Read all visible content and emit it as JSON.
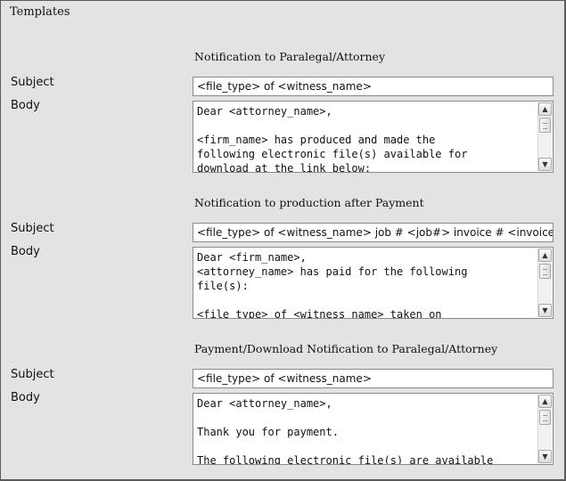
{
  "panel": {
    "title": "Templates"
  },
  "labels": {
    "subject": "Subject",
    "body": "Body"
  },
  "sections": [
    {
      "heading": "Notification to Paralegal/Attorney",
      "subject": "<file_type> of <witness_name>",
      "body": "Dear <attorney_name>,\n\n<firm_name> has produced and made the\nfollowing electronic file(s) available for\ndownload at the link below:"
    },
    {
      "heading": "Notification to production after Payment",
      "subject": "<file_type> of <witness_name>  job # <job#> invoice # <invoice#>",
      "body": "Dear <firm_name>,\n<attorney_name> has paid for the following\nfile(s):\n\n<file_type> of <witness_name> taken on"
    },
    {
      "heading": "Payment/Download Notification to Paralegal/Attorney",
      "subject": "<file_type> of <witness_name>",
      "body": "Dear <attorney_name>,\n\nThank you for payment.\n\nThe following electronic file(s) are available"
    }
  ],
  "icons": {
    "scroll_up": "scroll-up-arrow-icon",
    "scroll_down": "scroll-down-arrow-icon",
    "scroll_thumb": "scrollbar-thumb-grip-icon"
  }
}
